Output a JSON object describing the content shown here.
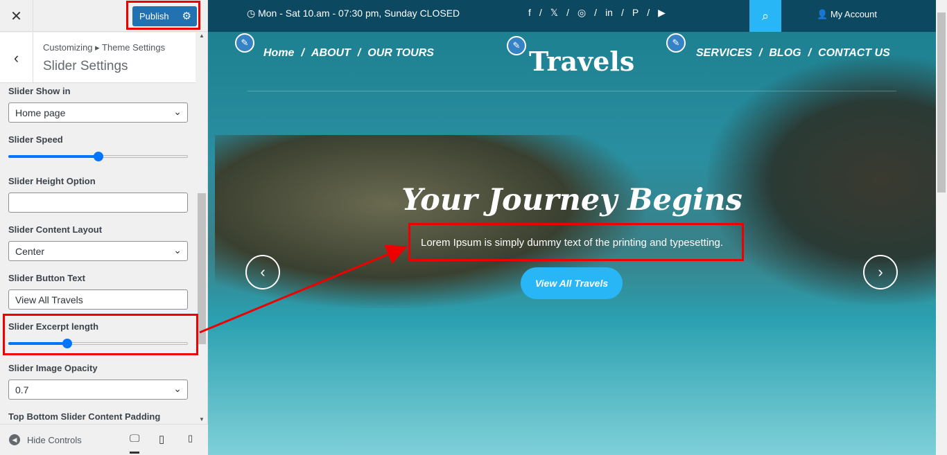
{
  "sidebar": {
    "close_icon": "close-icon",
    "publish_label": "Publish",
    "breadcrumb": "Customizing ▸ Theme Settings",
    "section_title": "Slider Settings",
    "controls": {
      "show_in": {
        "label": "Slider Show in",
        "value": "Home page"
      },
      "speed": {
        "label": "Slider Speed",
        "value_percent": 50
      },
      "height_option": {
        "label": "Slider Height Option",
        "value": ""
      },
      "content_layout": {
        "label": "Slider Content Layout",
        "value": "Center"
      },
      "button_text": {
        "label": "Slider Button Text",
        "value": "View All Travels"
      },
      "excerpt_length": {
        "label": "Slider Excerpt length",
        "value_percent": 33
      },
      "image_opacity": {
        "label": "Slider Image Opacity",
        "value": "0.7"
      },
      "padding": {
        "label": "Top Bottom Slider Content Padding"
      }
    },
    "footer": {
      "hide_controls": "Hide Controls"
    }
  },
  "preview": {
    "hours": "Mon - Sat 10.am - 07:30 pm, Sunday CLOSED",
    "social": [
      "f",
      "/",
      "𝕏",
      "/",
      "◎",
      "/",
      "in",
      "/",
      "P",
      "/",
      "▶"
    ],
    "account": "My Account",
    "nav_left": [
      "Home",
      "/",
      "ABOUT",
      "/",
      "OUR TOURS"
    ],
    "nav_right": [
      "SERVICES",
      "/",
      "BLOG",
      "/",
      "CONTACT US"
    ],
    "logo": "Travels",
    "heading": "Your Journey Begins",
    "excerpt": "Lorem Ipsum is simply dummy text of the printing and typesetting.",
    "button": "View All Travels"
  },
  "colors": {
    "accent": "#2271b1",
    "highlight": "#e00000",
    "site_accent": "#29b6f6"
  }
}
